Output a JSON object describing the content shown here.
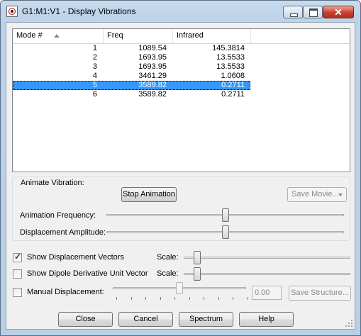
{
  "window": {
    "title": "G1:M1:V1 - Display Vibrations"
  },
  "table": {
    "headers": [
      "Mode #",
      "Freq",
      "Infrared"
    ],
    "rows": [
      {
        "mode": "1",
        "freq": "1089.54",
        "ir": "145.3814"
      },
      {
        "mode": "2",
        "freq": "1693.95",
        "ir": "13.5533"
      },
      {
        "mode": "3",
        "freq": "1693.95",
        "ir": "13.5533"
      },
      {
        "mode": "4",
        "freq": "3461.29",
        "ir": "1.0608"
      },
      {
        "mode": "5",
        "freq": "3589.82",
        "ir": "0.2711"
      },
      {
        "mode": "6",
        "freq": "3589.82",
        "ir": "0.2711"
      }
    ],
    "selected_row": 5
  },
  "animate": {
    "group_label": "Animate Vibration:",
    "stop_button": "Stop Animation",
    "save_movie_button": "Save Movie...",
    "frequency_label": "Animation Frequency:",
    "amplitude_label": "Displacement Amplitude:",
    "frequency_level": 0.5,
    "amplitude_level": 0.5
  },
  "options": {
    "show_displacement_vectors": {
      "label": "Show Displacement Vectors",
      "checked": true,
      "scale_label": "Scale:",
      "scale_level": 0.08
    },
    "show_dipole_vector": {
      "label": "Show Dipole Derivative Unit Vector",
      "checked": false,
      "scale_label": "Scale:",
      "scale_level": 0.08
    },
    "manual_displacement": {
      "label": "Manual Displacement:",
      "checked": false,
      "value": "0.00",
      "level": 0.5,
      "save_structure_button": "Save Structure..."
    }
  },
  "buttons": {
    "close": "Close",
    "cancel": "Cancel",
    "spectrum": "Spectrum",
    "help": "Help"
  },
  "colors": {
    "selection": "#3399ff",
    "title_bar": "#c8dbee",
    "close_button": "#c7402b"
  },
  "icons": {
    "app": "gaussview-app-icon",
    "minimize": "minimize-icon",
    "maximize": "maximize-icon",
    "close": "close-icon"
  }
}
